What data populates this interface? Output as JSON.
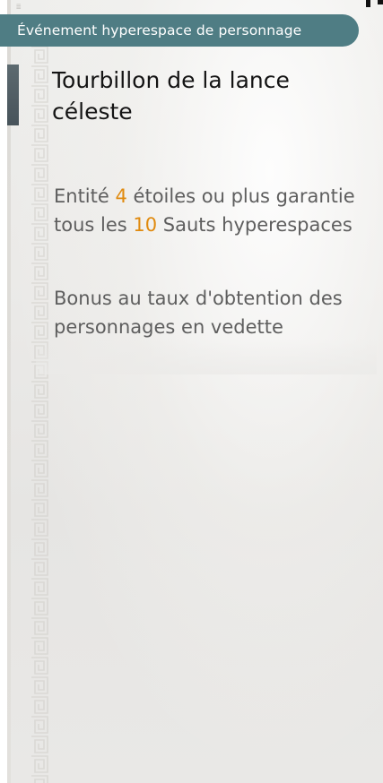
{
  "banner": {
    "text": "Événement hyperespace de personnage"
  },
  "header_mark": "≣",
  "title": "Tourbillon de la lance céleste",
  "guarantee": {
    "part1": "Entité ",
    "stars": "4",
    "part2": " étoiles ou plus garantie tous les ",
    "count": "10",
    "part3": " Sauts hyperespaces"
  },
  "bonus": {
    "text": "Bonus au taux d'obtention des personnages en vedette"
  },
  "colors": {
    "banner": "#4f7d84",
    "highlight": "#e08a0e",
    "accent_bar": "#55626a"
  }
}
